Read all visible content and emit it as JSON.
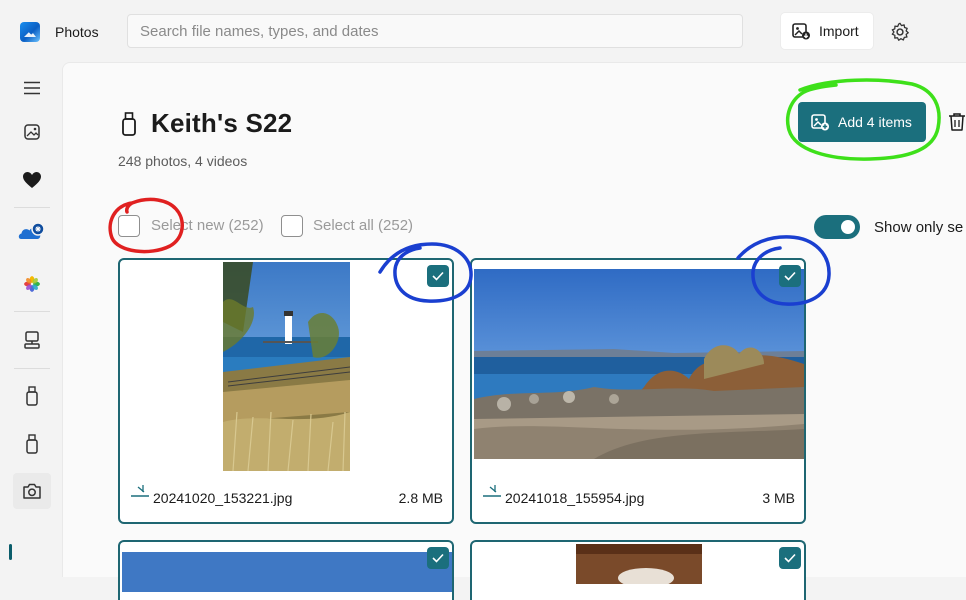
{
  "app": {
    "title": "Photos"
  },
  "search": {
    "placeholder": "Search file names, types, and dates"
  },
  "toolbar": {
    "import_label": "Import"
  },
  "device": {
    "name": "Keith's S22",
    "summary": "248 photos, 4 videos",
    "add_label": "Add 4 items",
    "select_new_label": "Select new (252)",
    "select_all_label": "Select all (252)",
    "show_only_label": "Show only se"
  },
  "sidebar": {
    "items": [
      {
        "icon": "hamburger-menu-icon"
      },
      {
        "icon": "gallery-icon"
      },
      {
        "icon": "heart-icon"
      },
      {
        "icon": "onedrive-icon"
      },
      {
        "icon": "icloud-photos-icon"
      },
      {
        "icon": "pc-icon"
      },
      {
        "icon": "usb-device-icon"
      },
      {
        "icon": "usb-device-icon"
      },
      {
        "icon": "camera-icon",
        "active": true
      }
    ]
  },
  "items": [
    {
      "filename": "20241020_153221.jpg",
      "size": "2.8 MB",
      "selected": true
    },
    {
      "filename": "20241018_155954.jpg",
      "size": "3 MB",
      "selected": true
    },
    {
      "filename": "",
      "size": "",
      "selected": true
    },
    {
      "filename": "",
      "size": "",
      "selected": true
    }
  ],
  "colors": {
    "accent": "#1b6f7d",
    "annotation_red": "#e02020",
    "annotation_blue": "#1a3fd0",
    "annotation_green": "#3ee01a"
  }
}
